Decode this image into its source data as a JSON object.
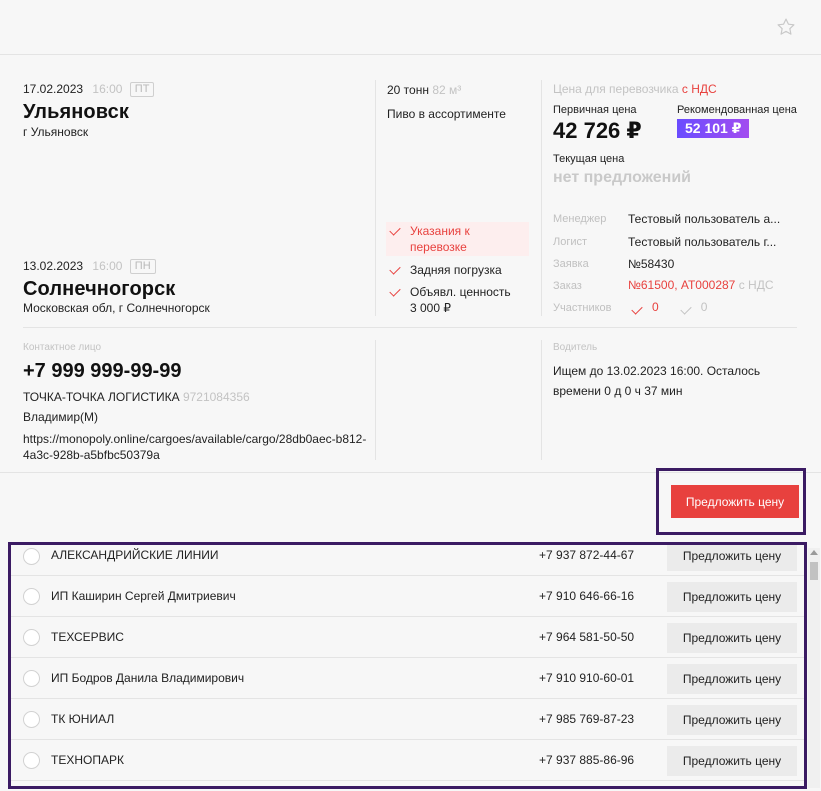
{
  "route": {
    "from": {
      "date": "17.02.2023",
      "time": "16:00",
      "day": "ПТ",
      "city": "Ульяновск",
      "address": "г Ульяновск"
    },
    "to": {
      "date": "13.02.2023",
      "time": "16:00",
      "day": "ПН",
      "city": "Солнечногорск",
      "address": "Московская обл, г Солнечногорск"
    }
  },
  "cargo": {
    "weight": "20 тонн",
    "volume": "82 м³",
    "name": "Пиво в ассортименте",
    "checks": [
      {
        "label": "Указания к перевозке",
        "style": "highlight"
      },
      {
        "label": "Задняя погрузка",
        "style": "normal"
      },
      {
        "label": "Объявл. ценность 3 000 ₽",
        "style": "normal"
      }
    ]
  },
  "price": {
    "header": "Цена для перевозчика",
    "vat": "с НДС",
    "primary_label": "Первичная цена",
    "primary_value": "42 726 ₽",
    "recommended_label": "Рекомендованная цена",
    "recommended_value": "52 101 ₽",
    "current_label": "Текущая цена",
    "current_value": "нет предложений"
  },
  "details": {
    "manager_label": "Менеджер",
    "manager_value": "Тестовый пользователь а...",
    "logist_label": "Логист",
    "logist_value": "Тестовый пользователь г...",
    "request_label": "Заявка",
    "request_value": "№58430",
    "order_label": "Заказ",
    "order_value": "№61500, АТ000287",
    "order_vat": "с НДС",
    "participants_label": "Участников",
    "participants_yes": "0",
    "participants_no": "0"
  },
  "contact": {
    "label": "Контактное лицо",
    "phone": "+7 999 999-99-99",
    "company": "ТОЧКА-ТОЧКА ЛОГИСТИКА",
    "inn": "9721084356",
    "person": "Владимир(М)",
    "link": "https://monopoly.online/cargoes/available/cargo/28db0aec-b812-4a3c-928b-a5bfbc50379a"
  },
  "driver": {
    "label": "Водитель",
    "status": "Ищем до 13.02.2023 16:00. Осталось времени 0 д 0 ч 37 мин"
  },
  "offer_button": "Предложить цену",
  "carriers": [
    {
      "name": "АЛЕКСАНДРИЙСКИЕ ЛИНИИ",
      "phone": "+7 937 872-44-67",
      "button": "Предложить цену"
    },
    {
      "name": "ИП Каширин Сергей Дмитриевич",
      "phone": "+7 910 646-66-16",
      "button": "Предложить цену"
    },
    {
      "name": "ТЕХСЕРВИС",
      "phone": "+7 964 581-50-50",
      "button": "Предложить цену"
    },
    {
      "name": "ИП Бодров Данила Владимирович",
      "phone": "+7 910 910-60-01",
      "button": "Предложить цену"
    },
    {
      "name": "ТК ЮНИАЛ",
      "phone": "+7 985 769-87-23",
      "button": "Предложить цену"
    },
    {
      "name": "ТЕХНОПАРК",
      "phone": "+7 937 885-86-96",
      "button": "Предложить цену"
    }
  ],
  "icons": {
    "favorite": "star-outline-icon",
    "check": "check-icon",
    "radio": "radio-icon"
  },
  "colors": {
    "accent": "#e8413e",
    "recommended": "#7b4cff",
    "highlight_bg": "#fdeeee",
    "frame": "#3b1b63"
  }
}
